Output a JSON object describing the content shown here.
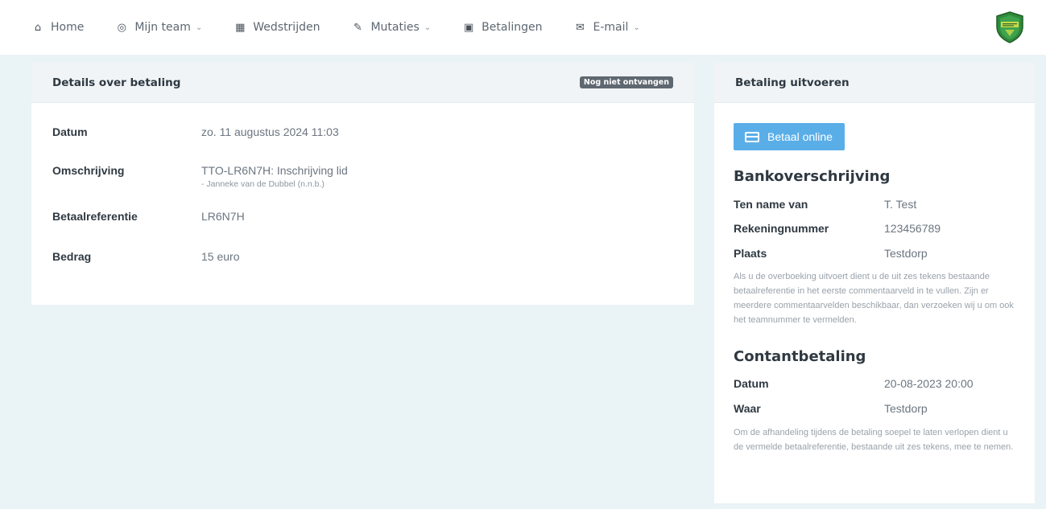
{
  "nav": {
    "items": [
      {
        "label": "Home",
        "icon": "home-icon",
        "glyph": "⌂",
        "dropdown": false
      },
      {
        "label": "Mijn team",
        "icon": "target-icon",
        "glyph": "◎",
        "dropdown": true
      },
      {
        "label": "Wedstrijden",
        "icon": "calendar-grid-icon",
        "glyph": "▦",
        "dropdown": false
      },
      {
        "label": "Mutaties",
        "icon": "edit-icon",
        "glyph": "✎",
        "dropdown": true
      },
      {
        "label": "Betalingen",
        "icon": "money-icon",
        "glyph": "▣",
        "dropdown": false
      },
      {
        "label": "E-mail",
        "icon": "envelope-icon",
        "glyph": "✉",
        "dropdown": true
      }
    ]
  },
  "details": {
    "title": "Details over betaling",
    "status_badge": "Nog niet ontvangen",
    "rows": [
      {
        "label": "Datum",
        "value": "zo. 11 augustus 2024 11:03",
        "sub": ""
      },
      {
        "label": "Omschrijving",
        "value": "TTO-LR6N7H: Inschrijving lid",
        "sub": "- Janneke van de Dubbel (n.n.b.)"
      },
      {
        "label": "Betaalreferentie",
        "value": "LR6N7H",
        "sub": ""
      },
      {
        "label": "Bedrag",
        "value": "15 euro",
        "sub": ""
      }
    ]
  },
  "payment": {
    "title": "Betaling uitvoeren",
    "pay_online_label": "Betaal online",
    "bank": {
      "title": "Bankoverschrijving",
      "rows": [
        {
          "label": "Ten name van",
          "value": "T. Test"
        },
        {
          "label": "Rekeningnummer",
          "value": "123456789"
        },
        {
          "label": "Plaats",
          "value": "Testdorp"
        }
      ],
      "note": "Als u de overboeking uitvoert dient u de uit zes tekens bestaande betaalreferentie in het eerste commentaarveld in te vullen. Zijn er meerdere commentaarvelden beschikbaar, dan verzoeken wij u om ook het teamnummer te vermelden."
    },
    "cash": {
      "title": "Contantbetaling",
      "rows": [
        {
          "label": "Datum",
          "value": "20-08-2023 20:00"
        },
        {
          "label": "Waar",
          "value": "Testdorp"
        }
      ],
      "note": "Om de afhandeling tijdens de betaling soepel te laten verlopen dient u de vermelde betaalreferentie, bestaande uit zes tekens, mee te nemen."
    }
  },
  "colors": {
    "background": "#eaf3f5",
    "button": "#5aaee8",
    "badge": "#5f6870",
    "logo_green": "#2e8b3a"
  }
}
